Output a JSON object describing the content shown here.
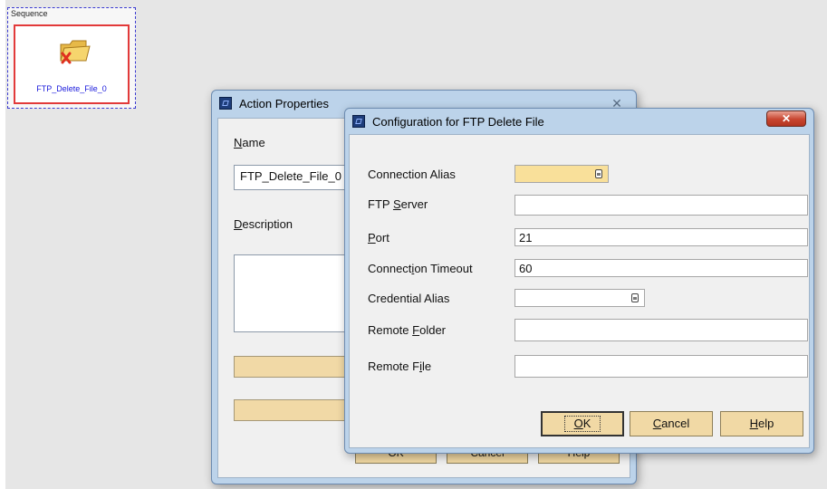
{
  "sequence": {
    "label": "Sequence",
    "node_label": "FTP_Delete_File_0"
  },
  "action_window": {
    "title": "Action Properties",
    "close_glyph": "✕",
    "name_label_first": "N",
    "name_label_rest": "ame",
    "name_value": "FTP_Delete_File_0",
    "description_label_first": "D",
    "description_label_rest": "escription",
    "ok_label": "OK",
    "cancel_label": "Cancel",
    "help_label": "Help"
  },
  "ftp_dialog": {
    "title": "Configuration for FTP Delete File",
    "close_glyph": "✕",
    "fields": {
      "connection_alias": {
        "label": "Connection Alias",
        "value": ""
      },
      "ftp_server": {
        "pre": "FTP ",
        "ul": "S",
        "post": "erver",
        "value": ""
      },
      "port": {
        "pre": "",
        "ul": "P",
        "post": "ort",
        "value": "21"
      },
      "connection_timeout": {
        "pre": "Connect",
        "ul": "i",
        "post": "on Timeout",
        "value": "60"
      },
      "credential_alias": {
        "label": "Credential Alias",
        "value": ""
      },
      "remote_folder": {
        "pre": "Remote ",
        "ul": "F",
        "post": "older",
        "value": ""
      },
      "remote_file": {
        "pre": "Remote F",
        "ul": "i",
        "post": "le",
        "value": ""
      }
    },
    "buttons": {
      "ok": {
        "ul": "O",
        "post": "K"
      },
      "cancel": {
        "ul": "C",
        "post": "ancel"
      },
      "help": {
        "ul": "H",
        "post": "elp"
      }
    }
  },
  "colors": {
    "desktop": "#e6e6e6",
    "window_frame": "#bcd3ea",
    "button_fill": "#f1d9a5",
    "combo_highlight": "#f9e09a",
    "node_border": "#e23a3a",
    "node_text": "#1a1adc",
    "close_button": "#c8452f"
  },
  "icons": {
    "title": "app-window-icon",
    "node": "folder-delete-icon",
    "combo": "combo-dropdown-icon"
  }
}
